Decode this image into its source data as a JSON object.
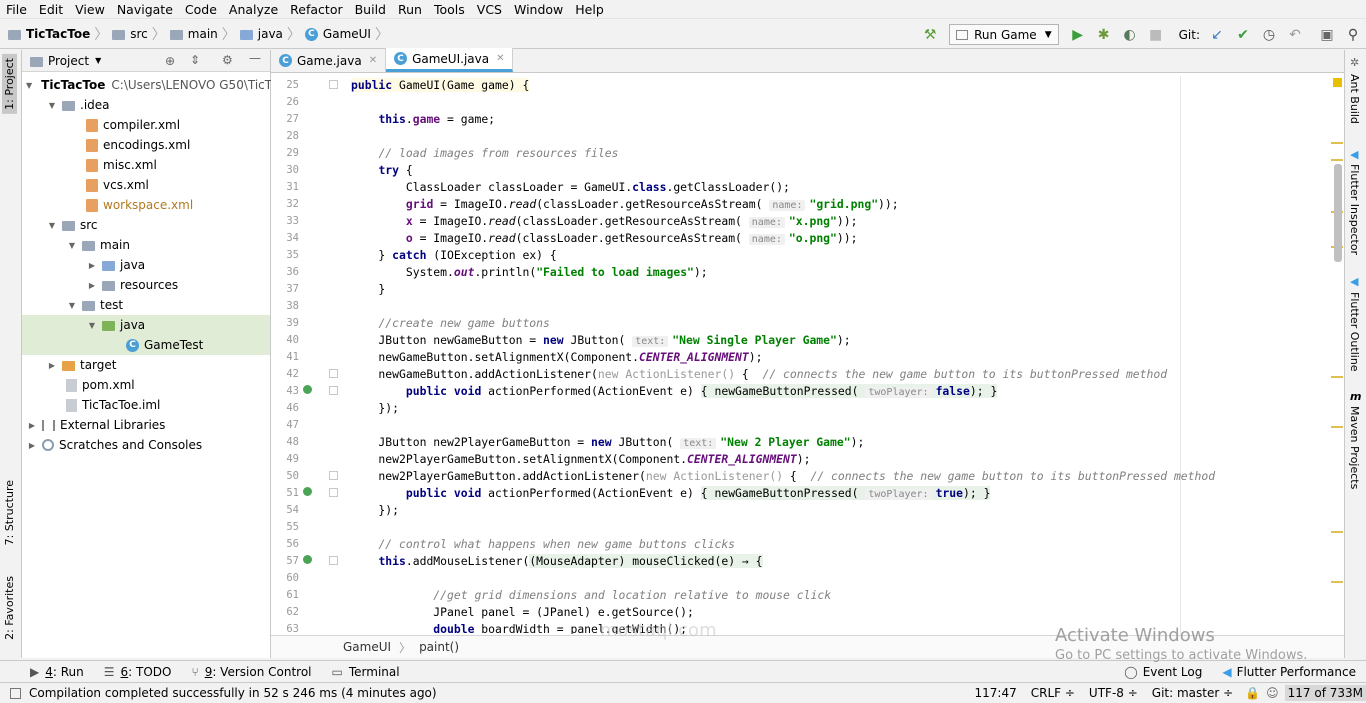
{
  "menu": [
    "File",
    "Edit",
    "View",
    "Navigate",
    "Code",
    "Analyze",
    "Refactor",
    "Build",
    "Run",
    "Tools",
    "VCS",
    "Window",
    "Help"
  ],
  "breadcrumb": [
    "TicTacToe",
    "src",
    "main",
    "java",
    "GameUI"
  ],
  "toolbar": {
    "run_config": "Run Game",
    "git_label": "Git:"
  },
  "project_panel": {
    "title": "Project",
    "root_label": "TicTacToe",
    "root_path": "C:\\Users\\LENOVO G50\\TicT",
    "items": [
      {
        "label": "TicTacToe"
      },
      {
        "label": ".idea"
      },
      {
        "label": "compiler.xml"
      },
      {
        "label": "encodings.xml"
      },
      {
        "label": "misc.xml"
      },
      {
        "label": "vcs.xml"
      },
      {
        "label": "workspace.xml"
      },
      {
        "label": "src"
      },
      {
        "label": "main"
      },
      {
        "label": "java"
      },
      {
        "label": "resources"
      },
      {
        "label": "test"
      },
      {
        "label": "java"
      },
      {
        "label": "GameTest"
      },
      {
        "label": "target"
      },
      {
        "label": "pom.xml"
      },
      {
        "label": "TicTacToe.iml"
      },
      {
        "label": "External Libraries"
      },
      {
        "label": "Scratches and Consoles"
      }
    ]
  },
  "left_tabs": {
    "project": "1: Project",
    "structure": "7: Structure",
    "favorites": "2: Favorites"
  },
  "right_tabs": {
    "ant": "Ant Build",
    "flutter_inspector": "Flutter Inspector",
    "flutter_outline": "Flutter Outline",
    "maven": "Maven Projects"
  },
  "editor_tabs": [
    {
      "label": "Game.java"
    },
    {
      "label": "GameUI.java"
    }
  ],
  "code_lines": [
    {
      "n": "25"
    },
    {
      "n": "26"
    },
    {
      "n": "27"
    },
    {
      "n": "28"
    },
    {
      "n": "29"
    },
    {
      "n": "30"
    },
    {
      "n": "31"
    },
    {
      "n": "32"
    },
    {
      "n": "33"
    },
    {
      "n": "34"
    },
    {
      "n": "35"
    },
    {
      "n": "36"
    },
    {
      "n": "37"
    },
    {
      "n": "38"
    },
    {
      "n": "39"
    },
    {
      "n": "40"
    },
    {
      "n": "41"
    },
    {
      "n": "42"
    },
    {
      "n": "43"
    },
    {
      "n": "46"
    },
    {
      "n": "47"
    },
    {
      "n": "48"
    },
    {
      "n": "49"
    },
    {
      "n": "50"
    },
    {
      "n": "51"
    },
    {
      "n": "54"
    },
    {
      "n": "55"
    },
    {
      "n": "56"
    },
    {
      "n": "57"
    },
    {
      "n": "60"
    },
    {
      "n": "61"
    },
    {
      "n": "62"
    },
    {
      "n": "63"
    }
  ],
  "editor_breadcrumb": {
    "cls": "GameUI",
    "method": "paint()"
  },
  "tool_windows": [
    {
      "num": "4",
      "label": ": Run"
    },
    {
      "num": "6",
      "label": ": TODO"
    },
    {
      "num": "9",
      "label": ": Version Control"
    },
    {
      "num": "",
      "label": "Terminal"
    }
  ],
  "tool_right": {
    "event_log": "Event Log",
    "flutter_perf": "Flutter Performance"
  },
  "status": {
    "message": "Compilation completed successfully in 52 s 246 ms (4 minutes ago)",
    "position": "117:47",
    "line_sep": "CRLF ÷",
    "encoding": "UTF-8 ÷",
    "git": "Git: master ÷",
    "memory": "117 of 733M"
  },
  "overlay": {
    "activate_title": "Activate Windows",
    "activate_sub": "Go to PC settings to activate Windows.",
    "watermark": "mostaql.com"
  }
}
